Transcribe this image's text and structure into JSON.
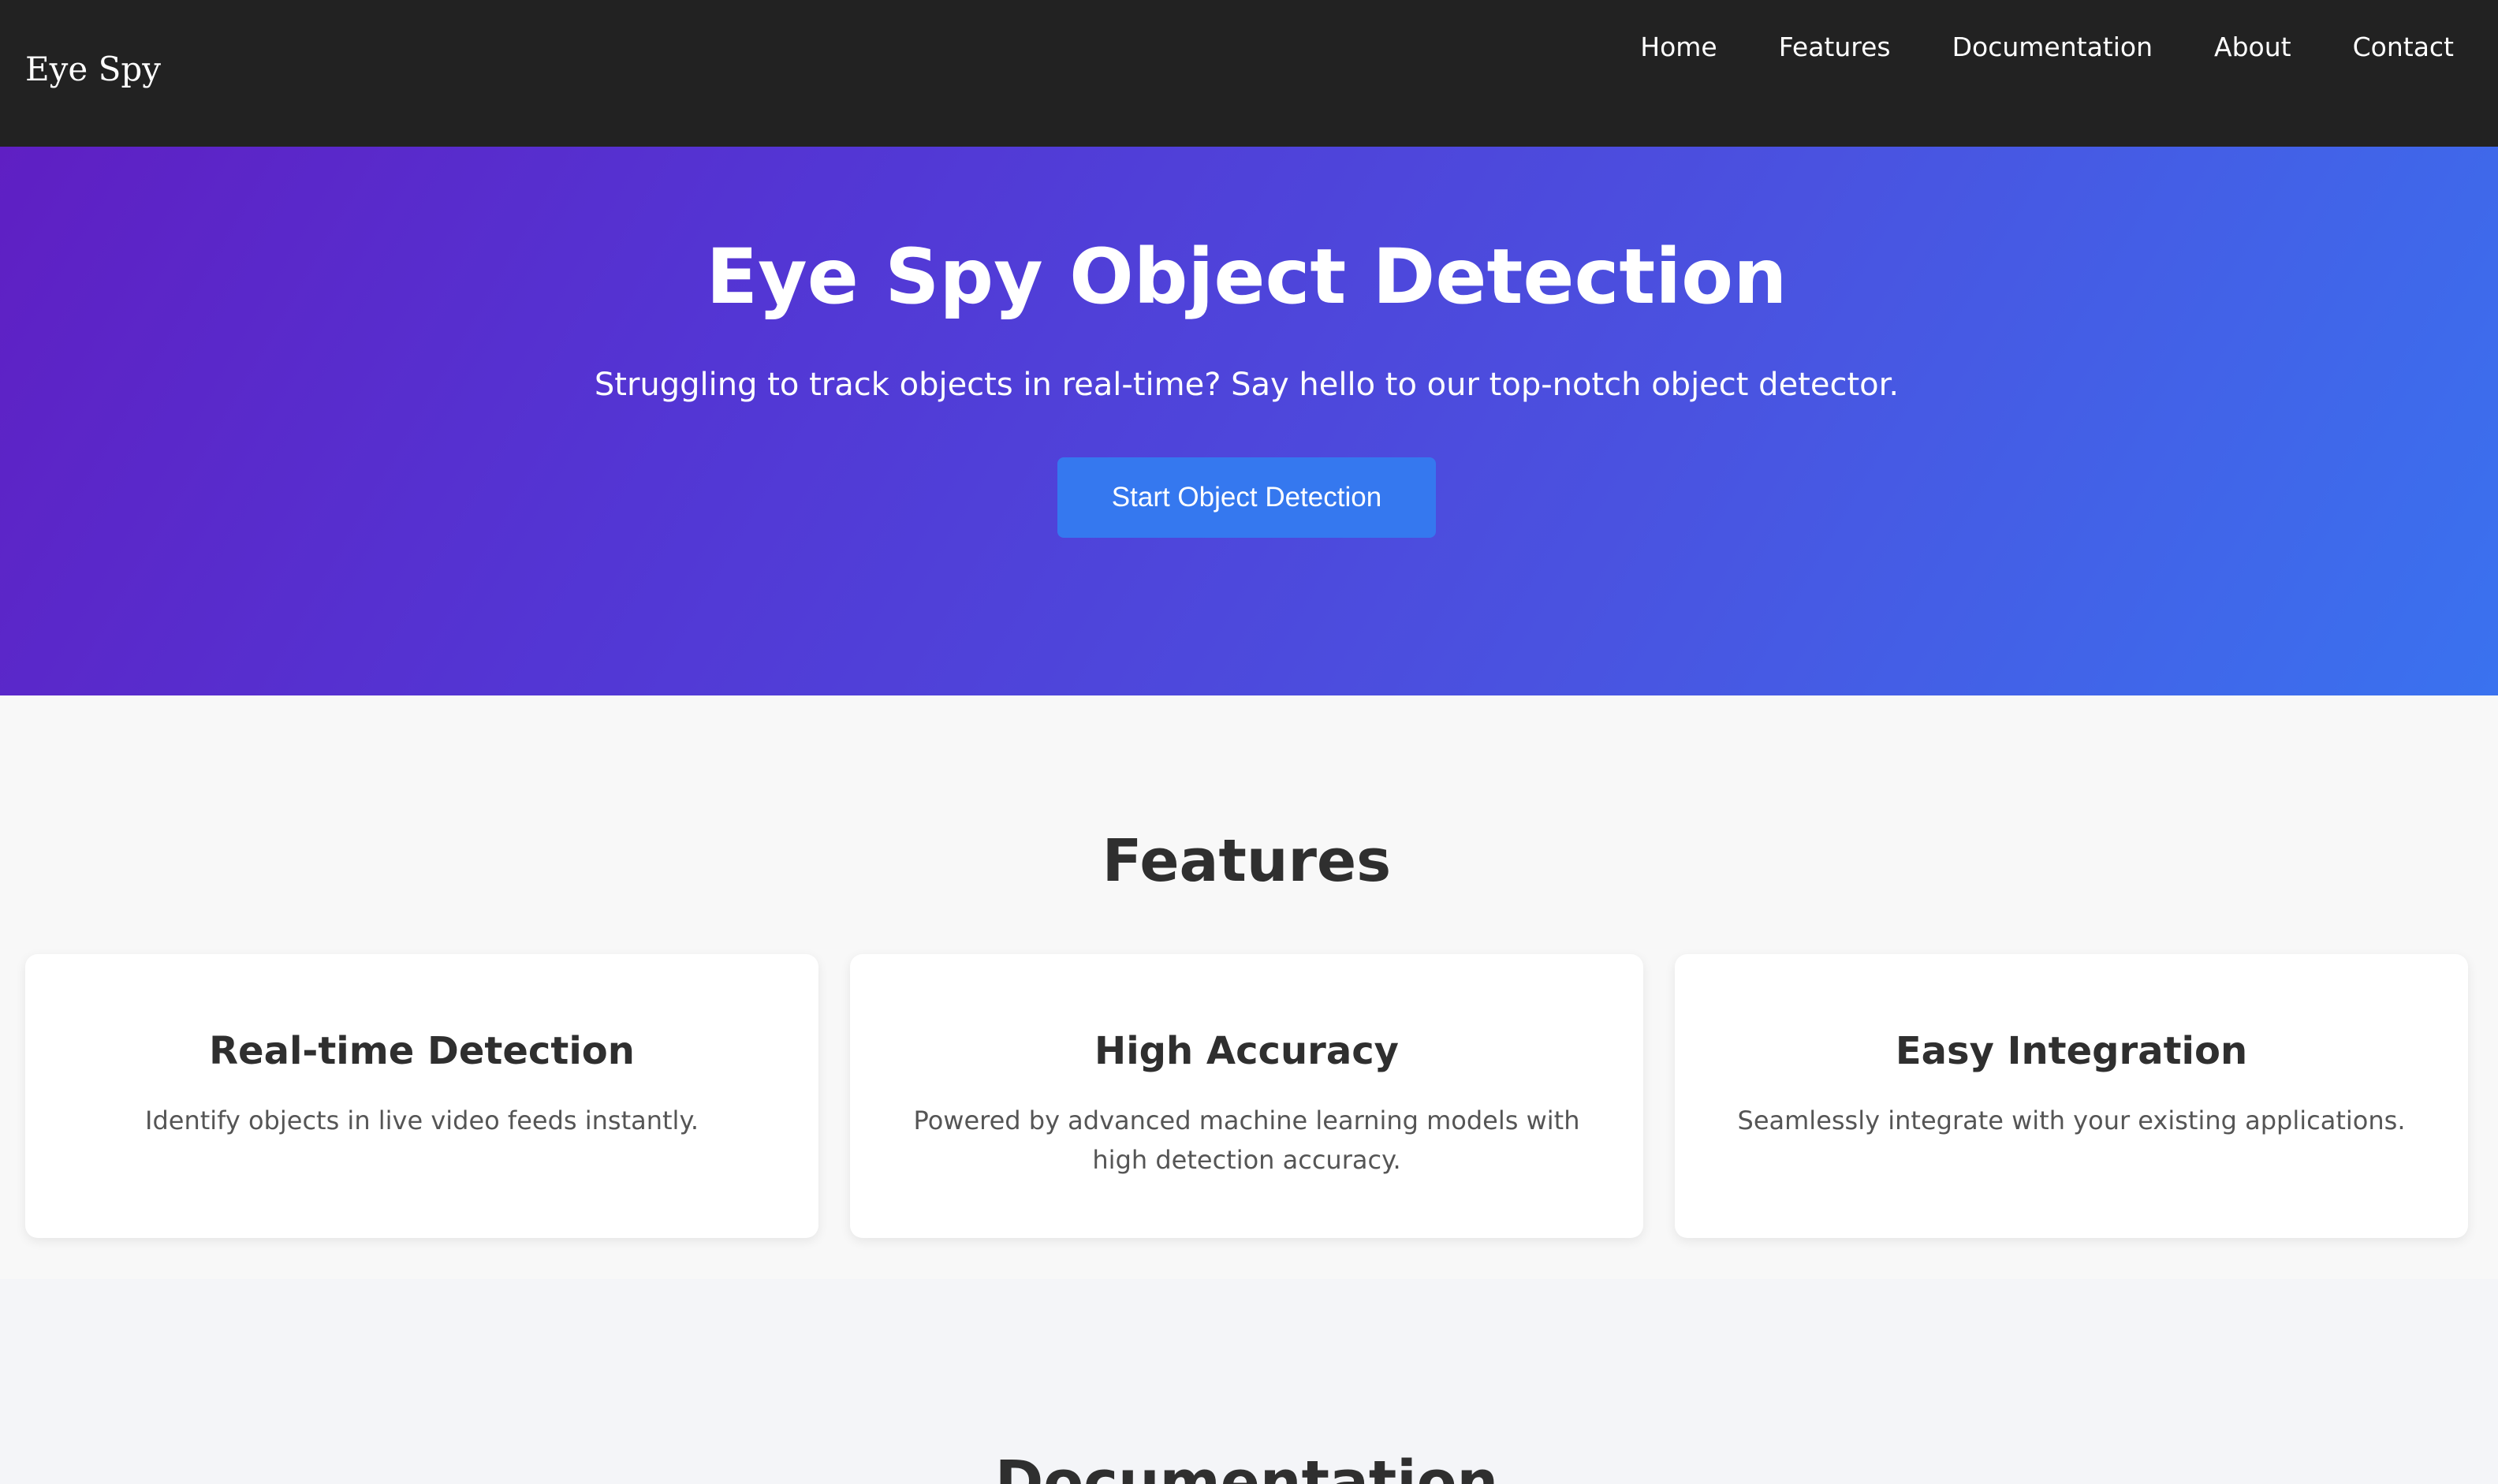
{
  "navbar": {
    "brand": "Eye Spy",
    "links": [
      {
        "label": "Home"
      },
      {
        "label": "Features"
      },
      {
        "label": "Documentation"
      },
      {
        "label": "About"
      },
      {
        "label": "Contact"
      }
    ]
  },
  "hero": {
    "title": "Eye Spy Object Detection",
    "subtitle": "Struggling to track objects in real-time? Say hello to our top-notch object detector.",
    "cta_label": "Start Object Detection"
  },
  "features": {
    "title": "Features",
    "cards": [
      {
        "title": "Real-time Detection",
        "description": "Identify objects in live video feeds instantly."
      },
      {
        "title": "High Accuracy",
        "description": "Powered by advanced machine learning models with high detection accuracy."
      },
      {
        "title": "Easy Integration",
        "description": "Seamlessly integrate with your existing applications."
      }
    ]
  },
  "documentation": {
    "title": "Documentation"
  },
  "colors": {
    "navbar_bg": "#222222",
    "hero_gradient_start": "#5f1fc3",
    "hero_gradient_end": "#3a72ef",
    "cta_bg": "#3578ef",
    "page_bg": "#f8f8f8"
  }
}
